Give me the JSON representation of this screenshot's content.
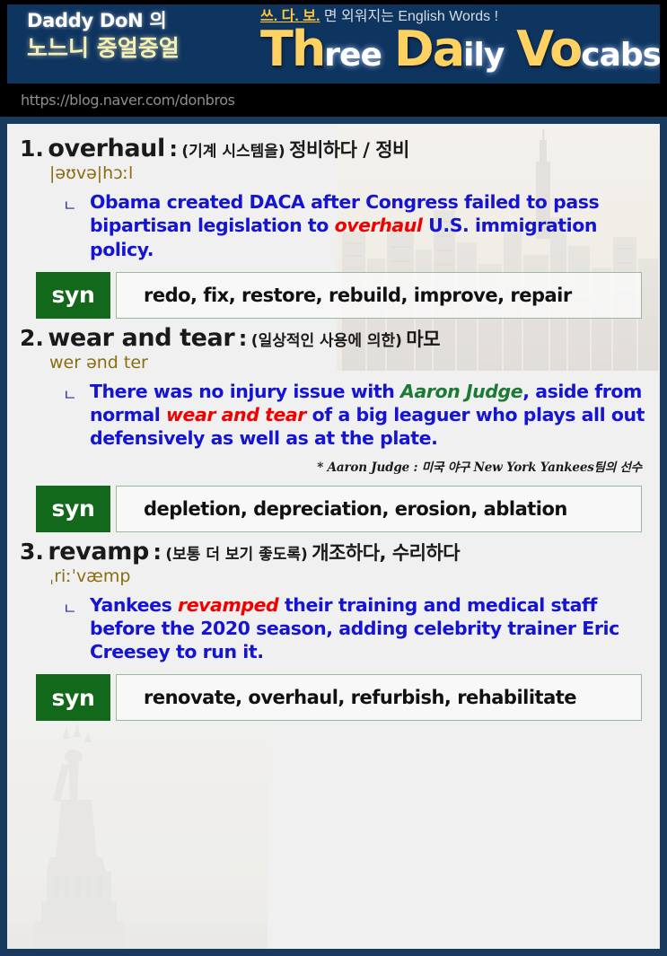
{
  "header": {
    "brand_line1": "Daddy DoN 의",
    "brand_line2": "노느니 중얼중얼",
    "tagline_highlight": "쓰. 다. 보.",
    "tagline_rest": " 면 외워지는 English Words !",
    "title_parts": [
      {
        "big": "Th",
        "small": "ree"
      },
      {
        "big": "Da",
        "small": "ily"
      },
      {
        "big": "Vo",
        "small": "cabs"
      }
    ],
    "url": "https://blog.naver.com/donbros",
    "colors": {
      "banner_bg": "#0e3460",
      "frame": "#173a5e",
      "title_yellow": "#ffd161",
      "title_white": "#ffffff",
      "brand_cream": "#f5f0b8",
      "url_text": "#8e8e8e"
    }
  },
  "entries": [
    {
      "number": "1.",
      "word": "overhaul",
      "colon": ":",
      "sense_paren": "(기계 시스템을)",
      "sense_korean": "정비하다 / 정비",
      "phonetic": "|əʊvə|hɔːl",
      "bullet": "ㄴ",
      "example": {
        "segments": [
          {
            "text": "Obama created DACA after Congress failed to pass bipartisan legislation to ",
            "style": "plain"
          },
          {
            "text": "overhaul",
            "style": "red-italic"
          },
          {
            "text": " U.S. immigration policy.",
            "style": "plain"
          }
        ]
      },
      "footnote": "",
      "syn_label": "syn",
      "syn_text": "redo, fix, restore, rebuild, improve, repair"
    },
    {
      "number": "2.",
      "word": "wear and tear",
      "colon": ":",
      "sense_paren": "(일상적인 사용에 의한)",
      "sense_korean": "마모",
      "phonetic": "wer ənd ter",
      "bullet": "ㄴ",
      "example": {
        "segments": [
          {
            "text": "There was no injury issue with ",
            "style": "plain"
          },
          {
            "text": "Aaron Judge",
            "style": "green-italic"
          },
          {
            "text": ", aside from normal ",
            "style": "plain"
          },
          {
            "text": "wear and tear",
            "style": "red-italic"
          },
          {
            "text": " of a big leaguer who plays all out defensively as well as at the plate.",
            "style": "plain"
          }
        ]
      },
      "footnote": "* Aaron Judge : 미국 야구 New York Yankees팀의 선수",
      "syn_label": "syn",
      "syn_text": "depletion, depreciation, erosion, ablation"
    },
    {
      "number": "3.",
      "word": "revamp",
      "colon": ":",
      "sense_paren": "(보통 더 보기 좋도록)",
      "sense_korean": "개조하다, 수리하다",
      "phonetic": "ˌriːˈvæmp",
      "bullet": "ㄴ",
      "example": {
        "segments": [
          {
            "text": "Yankees ",
            "style": "plain"
          },
          {
            "text": "revamped",
            "style": "red-italic"
          },
          {
            "text": " their training and medical staff before the 2020 season, adding celebrity trainer Eric Creesey to run it.",
            "style": "plain"
          }
        ]
      },
      "footnote": "",
      "syn_label": "syn",
      "syn_text": "renovate, overhaul, refurbish, rehabilitate"
    }
  ],
  "theme": {
    "example_blue": "#1414d2",
    "emphasis_red": "#f20000",
    "emphasis_green": "#1d7a36",
    "phonetic_gold": "#8a6d10",
    "syn_green": "#13691b",
    "card_bg": "#f0f0f0"
  }
}
